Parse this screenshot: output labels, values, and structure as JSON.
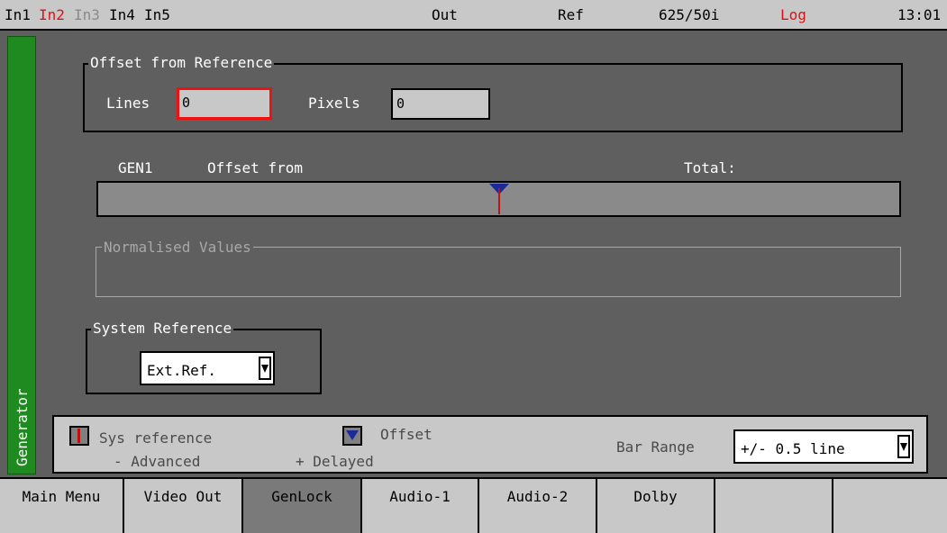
{
  "statusbar": {
    "inputs": [
      {
        "label": "In1",
        "color": "#000000"
      },
      {
        "label": "In2",
        "color": "#e01010"
      },
      {
        "label": "In3",
        "color": "#8a8a8a"
      },
      {
        "label": "In4",
        "color": "#000000"
      },
      {
        "label": "In5",
        "color": "#000000"
      }
    ],
    "out": "Out",
    "ref": "Ref",
    "format": "625/50i",
    "log": "Log",
    "log_color": "#e01010",
    "time": "13:01"
  },
  "side_tab": {
    "label": "Generator",
    "color": "#1f8a1f"
  },
  "offset_from_reference": {
    "legend": "Offset from Reference",
    "lines_label": "Lines",
    "lines_value": "0",
    "pixels_label": "Pixels",
    "pixels_value": "0"
  },
  "offset_bar": {
    "gen_label": "GEN1",
    "offset_label": "Offset from",
    "total_label": "Total:"
  },
  "normalised_values": {
    "legend": "Normalised Values"
  },
  "system_reference": {
    "legend": "System Reference",
    "selected": "Ext.Ref."
  },
  "bottom_panel": {
    "sys_reference_label": "Sys reference",
    "advanced_label": "- Advanced",
    "offset_label": "Offset",
    "delayed_label": "+ Delayed",
    "bar_range_label": "Bar Range",
    "bar_range_value": "+/- 0.5 line"
  },
  "softkeys": [
    {
      "label": "Main Menu",
      "selected": false
    },
    {
      "label": "Video Out",
      "selected": false
    },
    {
      "label": "GenLock",
      "selected": true
    },
    {
      "label": "Audio-1",
      "selected": false
    },
    {
      "label": "Audio-2",
      "selected": false
    },
    {
      "label": "Dolby",
      "selected": false
    },
    {
      "label": "",
      "selected": false
    },
    {
      "label": "",
      "selected": false
    }
  ]
}
